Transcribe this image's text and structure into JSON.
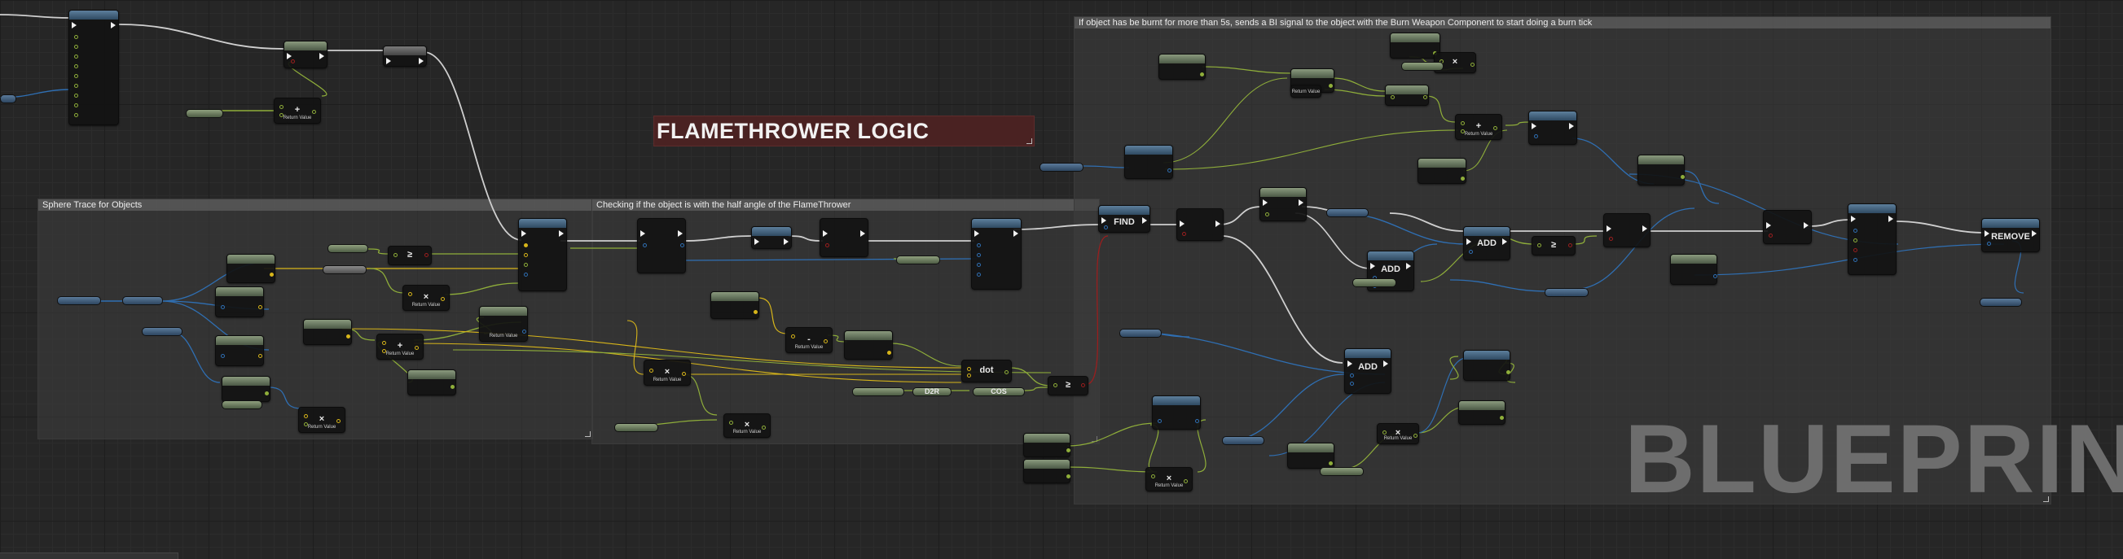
{
  "graph": {
    "title_comment": "FLAMETHROWER LOGIC",
    "watermark": "BLUEPRINT",
    "comments": {
      "sphere_trace": "Sphere Trace for Objects",
      "half_angle": "Checking if the object is with the half angle of the FlameThrower",
      "burn_signal": "If object has be burnt for more than 5s, sends a BI signal to the object with the Burn Weapon Component to start doing a burn tick"
    },
    "node_labels": {
      "find": "FIND",
      "add": "ADD",
      "remove": "REMOVE",
      "dot": "dot",
      "d2r": "D2R",
      "cos": "COS",
      "multiply": "×",
      "plus": "+",
      "greater_equal": "≥",
      "less": "<",
      "return_value": "Return Value"
    },
    "colors": {
      "background": "#262626",
      "exec_wire": "#cfcfcf",
      "object_wire": "#2f6fb3",
      "float_wire": "#8fae3a",
      "bool_wire": "#9a1e1e",
      "vector_wire": "#d7b51a",
      "title_comment": "#4a2222",
      "blue_header": "#3d5a76",
      "green_header": "#5f6d56"
    }
  }
}
